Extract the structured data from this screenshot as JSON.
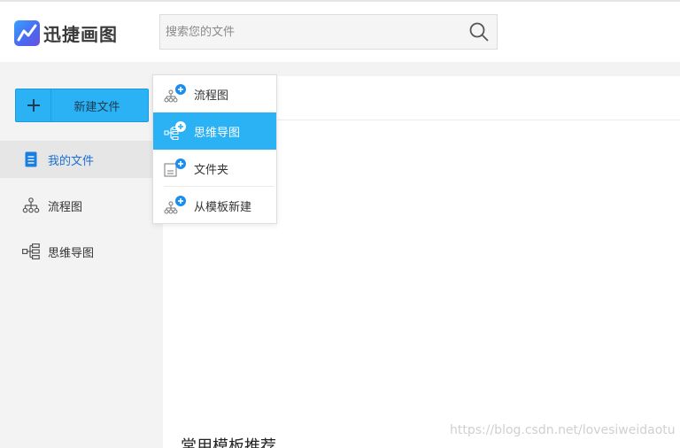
{
  "app": {
    "name": "迅捷画图"
  },
  "search": {
    "placeholder": "搜索您的文件"
  },
  "sidebar": {
    "new_file_label": "新建文件",
    "items": [
      {
        "label": "我的文件",
        "icon": "document-icon",
        "active": true
      },
      {
        "label": "流程图",
        "icon": "flowchart-icon",
        "active": false
      },
      {
        "label": "思维导图",
        "icon": "mindmap-icon",
        "active": false
      }
    ]
  },
  "dropdown": {
    "items": [
      {
        "label": "流程图",
        "icon": "add-flowchart-icon",
        "active": false
      },
      {
        "label": "思维导图",
        "icon": "add-mindmap-icon",
        "active": true
      },
      {
        "label": "文件夹",
        "icon": "add-folder-icon",
        "active": false
      },
      {
        "label": "从模板新建",
        "icon": "add-from-template-icon",
        "active": false
      }
    ]
  },
  "main": {
    "section_title": "常用模板推荐"
  },
  "watermark": "https://blog.csdn.net/lovesiweidaotu",
  "colors": {
    "accent": "#2ab2f4",
    "active_link": "#1a6fd6",
    "sidebar_bg": "#f3f3f3"
  }
}
